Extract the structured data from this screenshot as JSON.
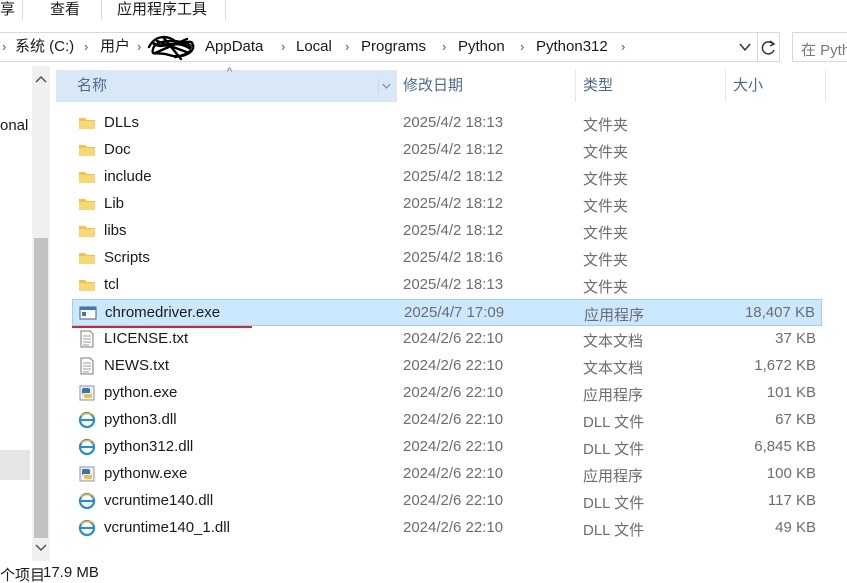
{
  "ribbon": {
    "tabs": [
      {
        "label": "享"
      },
      {
        "label": "查看"
      },
      {
        "label": "应用程序工具"
      }
    ]
  },
  "address": {
    "crumbs": [
      "系统 (C:)",
      "用户",
      "AppData",
      "Local",
      "Programs",
      "Python",
      "Python312"
    ],
    "search_placeholder": "在 Pytho"
  },
  "nav": {
    "partial_text": "onal"
  },
  "columns": {
    "name": "名称",
    "date": "修改日期",
    "type": "类型",
    "size": "大小"
  },
  "files": [
    {
      "name": "DLLs",
      "date": "2025/4/2 18:13",
      "type": "文件夹",
      "size": "",
      "icon": "folder-icon"
    },
    {
      "name": "Doc",
      "date": "2025/4/2 18:12",
      "type": "文件夹",
      "size": "",
      "icon": "folder-icon"
    },
    {
      "name": "include",
      "date": "2025/4/2 18:12",
      "type": "文件夹",
      "size": "",
      "icon": "folder-icon"
    },
    {
      "name": "Lib",
      "date": "2025/4/2 18:12",
      "type": "文件夹",
      "size": "",
      "icon": "folder-icon"
    },
    {
      "name": "libs",
      "date": "2025/4/2 18:12",
      "type": "文件夹",
      "size": "",
      "icon": "folder-icon"
    },
    {
      "name": "Scripts",
      "date": "2025/4/2 18:16",
      "type": "文件夹",
      "size": "",
      "icon": "folder-icon"
    },
    {
      "name": "tcl",
      "date": "2025/4/2 18:13",
      "type": "文件夹",
      "size": "",
      "icon": "folder-icon"
    },
    {
      "name": "chromedriver.exe",
      "date": "2025/4/7 17:09",
      "type": "应用程序",
      "size": "18,407 KB",
      "icon": "exe-window-icon",
      "selected": true
    },
    {
      "name": "LICENSE.txt",
      "date": "2024/2/6 22:10",
      "type": "文本文档",
      "size": "37 KB",
      "icon": "text-file-icon"
    },
    {
      "name": "NEWS.txt",
      "date": "2024/2/6 22:10",
      "type": "文本文档",
      "size": "1,672 KB",
      "icon": "text-file-icon"
    },
    {
      "name": "python.exe",
      "date": "2024/2/6 22:10",
      "type": "应用程序",
      "size": "101 KB",
      "icon": "python-icon"
    },
    {
      "name": "python3.dll",
      "date": "2024/2/6 22:10",
      "type": "DLL 文件",
      "size": "67 KB",
      "icon": "dll-icon"
    },
    {
      "name": "python312.dll",
      "date": "2024/2/6 22:10",
      "type": "DLL 文件",
      "size": "6,845 KB",
      "icon": "dll-icon"
    },
    {
      "name": "pythonw.exe",
      "date": "2024/2/6 22:10",
      "type": "应用程序",
      "size": "100 KB",
      "icon": "python-icon"
    },
    {
      "name": "vcruntime140.dll",
      "date": "2024/2/6 22:10",
      "type": "DLL 文件",
      "size": "117 KB",
      "icon": "dll-icon"
    },
    {
      "name": "vcruntime140_1.dll",
      "date": "2024/2/6 22:10",
      "type": "DLL 文件",
      "size": "49 KB",
      "icon": "dll-icon"
    }
  ],
  "status": {
    "items": "个项目",
    "selected_size": "17.9 MB"
  },
  "colors": {
    "selection": "#cce8ff",
    "selection_border": "#99d1ff",
    "header_text": "#4b6a8f",
    "annotation": "#d8262d",
    "folder": "#f3c33b"
  }
}
